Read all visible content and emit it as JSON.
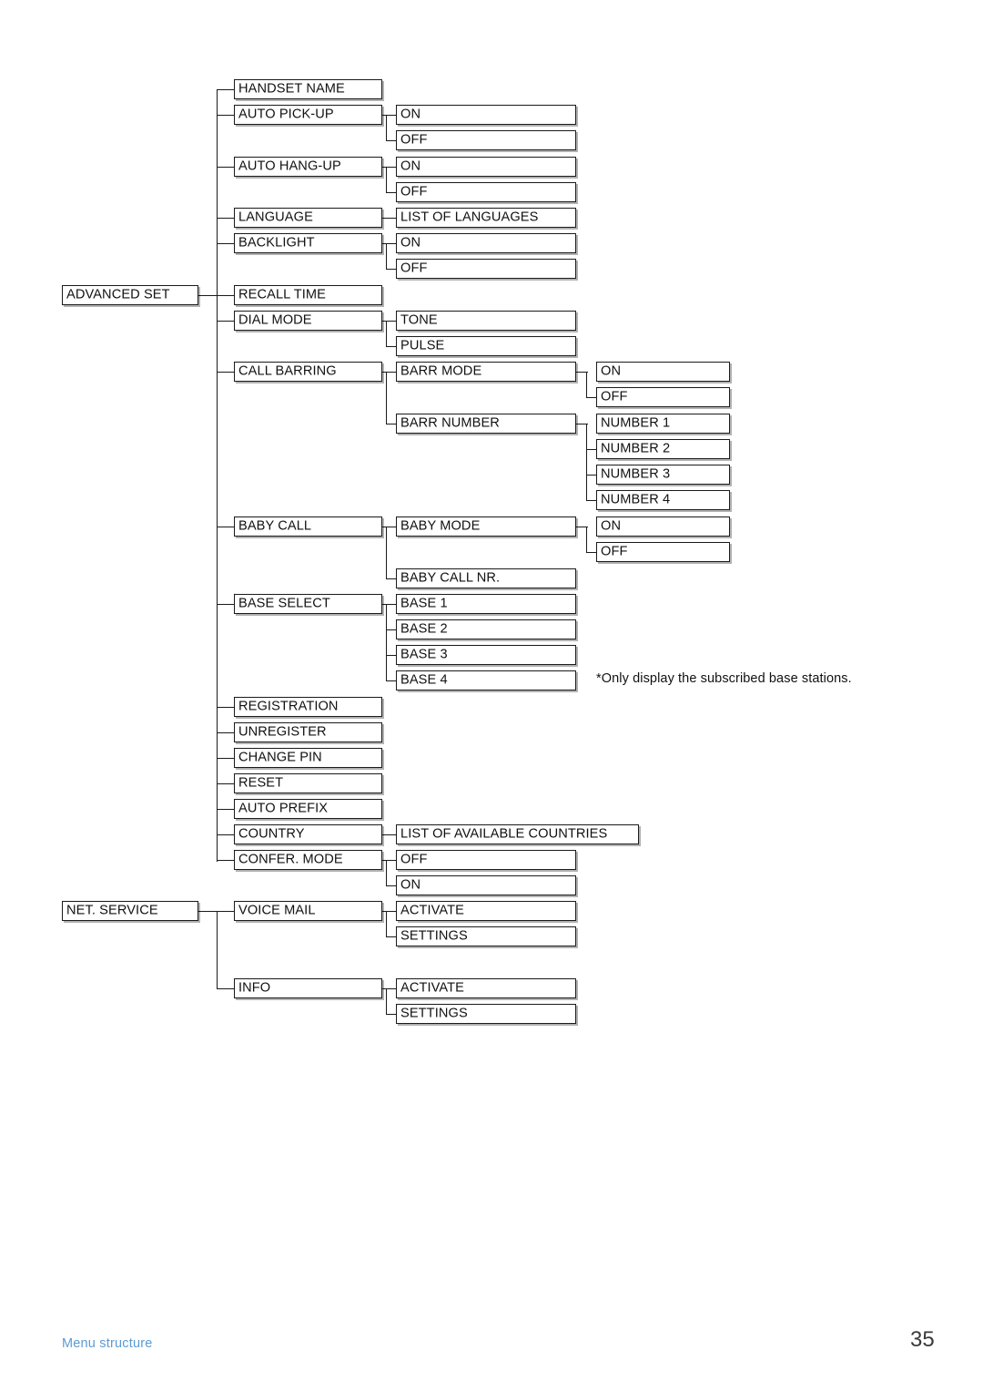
{
  "document": {
    "footer_label": "Menu structure",
    "page_number": "35",
    "footnote": "*Only display the subscribed base stations."
  },
  "nodes": {
    "advanced_set": "ADVANCED SET",
    "net_service": "NET. SERVICE",
    "handset_name": "HANDSET NAME",
    "auto_pick_up": "AUTO PICK-UP",
    "auto_pick_up_on": "ON",
    "auto_pick_up_off": "OFF",
    "auto_hang_up": "AUTO HANG-UP",
    "auto_hang_up_on": "ON",
    "auto_hang_up_off": "OFF",
    "language": "LANGUAGE",
    "language_list": "LIST OF LANGUAGES",
    "backlight": "BACKLIGHT",
    "backlight_on": "ON",
    "backlight_off": "OFF",
    "recall_time": "RECALL TIME",
    "dial_mode": "DIAL MODE",
    "dial_mode_tone": "TONE",
    "dial_mode_pulse": "PULSE",
    "call_barring": "CALL BARRING",
    "barr_mode": "BARR MODE",
    "barr_mode_on": "ON",
    "barr_mode_off": "OFF",
    "barr_number": "BARR NUMBER",
    "barr_number_1": "NUMBER 1",
    "barr_number_2": "NUMBER 2",
    "barr_number_3": "NUMBER 3",
    "barr_number_4": "NUMBER 4",
    "baby_call": "BABY CALL",
    "baby_mode": "BABY MODE",
    "baby_mode_on": "ON",
    "baby_mode_off": "OFF",
    "baby_call_nr": "BABY CALL NR.",
    "base_select": "BASE SELECT",
    "base_1": "BASE 1",
    "base_2": "BASE 2",
    "base_3": "BASE 3",
    "base_4": "BASE 4",
    "registration": "REGISTRATION",
    "unregister": "UNREGISTER",
    "change_pin": "CHANGE PIN",
    "reset": "RESET",
    "auto_prefix": "AUTO PREFIX",
    "country": "COUNTRY",
    "country_list": "LIST OF AVAILABLE COUNTRIES",
    "confer_mode": "CONFER. MODE",
    "confer_mode_off": "OFF",
    "confer_mode_on": "ON",
    "voice_mail": "VOICE MAIL",
    "voice_mail_activate": "ACTIVATE",
    "voice_mail_settings": "SETTINGS",
    "info": "INFO",
    "info_activate": "ACTIVATE",
    "info_settings": "SETTINGS"
  },
  "colors": {
    "line": "#1a1a1a",
    "text": "#111111",
    "footer_accent": "#5b9bd5"
  }
}
